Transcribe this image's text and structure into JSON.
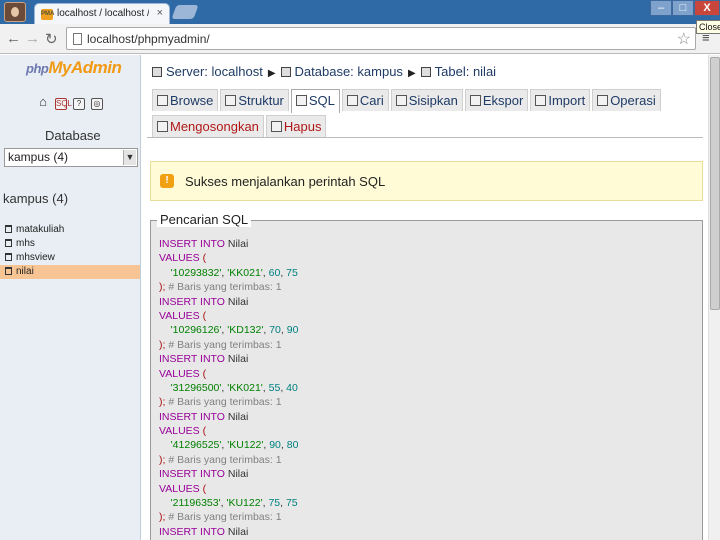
{
  "browser": {
    "tab_title": "localhost / localhost / kampus",
    "tab_close": "×",
    "favicon_text": "PMA",
    "url": "localhost/phpmyadmin/",
    "minimize": "–",
    "maximize": "□",
    "close": "X",
    "close_tooltip": "Close"
  },
  "sidebar": {
    "logo_php": "php",
    "logo_my": "My",
    "logo_admin": "Admin",
    "database_label": "Database",
    "database_select": "kampus (4)",
    "database_heading": "kampus (4)",
    "tables": [
      "matakuliah",
      "mhs",
      "mhsview",
      "nilai"
    ],
    "active_table": "nilai"
  },
  "breadcrumb": {
    "server": "Server: localhost",
    "database": "Database: kampus",
    "table": "Tabel: nilai"
  },
  "tabs_row1": [
    "Browse",
    "Struktur",
    "SQL",
    "Cari",
    "Sisipkan",
    "Ekspor",
    "Import",
    "Operasi"
  ],
  "tabs_row2": [
    "Mengosongkan",
    "Hapus"
  ],
  "active_tab": "SQL",
  "message": {
    "text": "Sukses menjalankan perintah SQL"
  },
  "sql_panel": {
    "legend": "Pencarian SQL",
    "lines": [
      {
        "kw": "INSERT INTO",
        "rest": " Nilai",
        "type": "insert"
      },
      {
        "kw": "VALUES",
        "rest": " (",
        "type": "values"
      },
      {
        "vals": [
          "'10293832'",
          "'KK021'",
          "60",
          "75"
        ],
        "type": "data"
      },
      {
        "comment": "# Baris yang terimbas: 1",
        "type": "close"
      },
      {
        "kw": "INSERT INTO",
        "rest": " Nilai",
        "type": "insert"
      },
      {
        "kw": "VALUES",
        "rest": " (",
        "type": "values"
      },
      {
        "vals": [
          "'10296126'",
          "'KD132'",
          "70",
          "90"
        ],
        "type": "data"
      },
      {
        "comment": "# Baris yang terimbas: 1",
        "type": "close"
      },
      {
        "kw": "INSERT INTO",
        "rest": " Nilai",
        "type": "insert"
      },
      {
        "kw": "VALUES",
        "rest": " (",
        "type": "values"
      },
      {
        "vals": [
          "'31296500'",
          "'KK021'",
          "55",
          "40"
        ],
        "type": "data"
      },
      {
        "comment": "# Baris yang terimbas: 1",
        "type": "close"
      },
      {
        "kw": "INSERT INTO",
        "rest": " Nilai",
        "type": "insert"
      },
      {
        "kw": "VALUES",
        "rest": " (",
        "type": "values"
      },
      {
        "vals": [
          "'41296525'",
          "'KU122'",
          "90",
          "80"
        ],
        "type": "data"
      },
      {
        "comment": "# Baris yang terimbas: 1",
        "type": "close"
      },
      {
        "kw": "INSERT INTO",
        "rest": " Nilai",
        "type": "insert"
      },
      {
        "kw": "VALUES",
        "rest": " (",
        "type": "values"
      },
      {
        "vals": [
          "'21196353'",
          "'KU122'",
          "75",
          "75"
        ],
        "type": "data"
      },
      {
        "comment": "# Baris yang terimbas: 1",
        "type": "close"
      },
      {
        "kw": "INSERT INTO",
        "rest": " Nilai",
        "type": "insert"
      }
    ]
  },
  "colors": {
    "tabstrip": "#2f6aa6",
    "left_panel": "#e8eef4",
    "active_table_highlight": "#f7c594",
    "success_bg": "#fffbd6",
    "sql_keyword": "#990099",
    "sql_string": "#008000",
    "sql_number": "#008080",
    "sql_comment": "#808080"
  }
}
